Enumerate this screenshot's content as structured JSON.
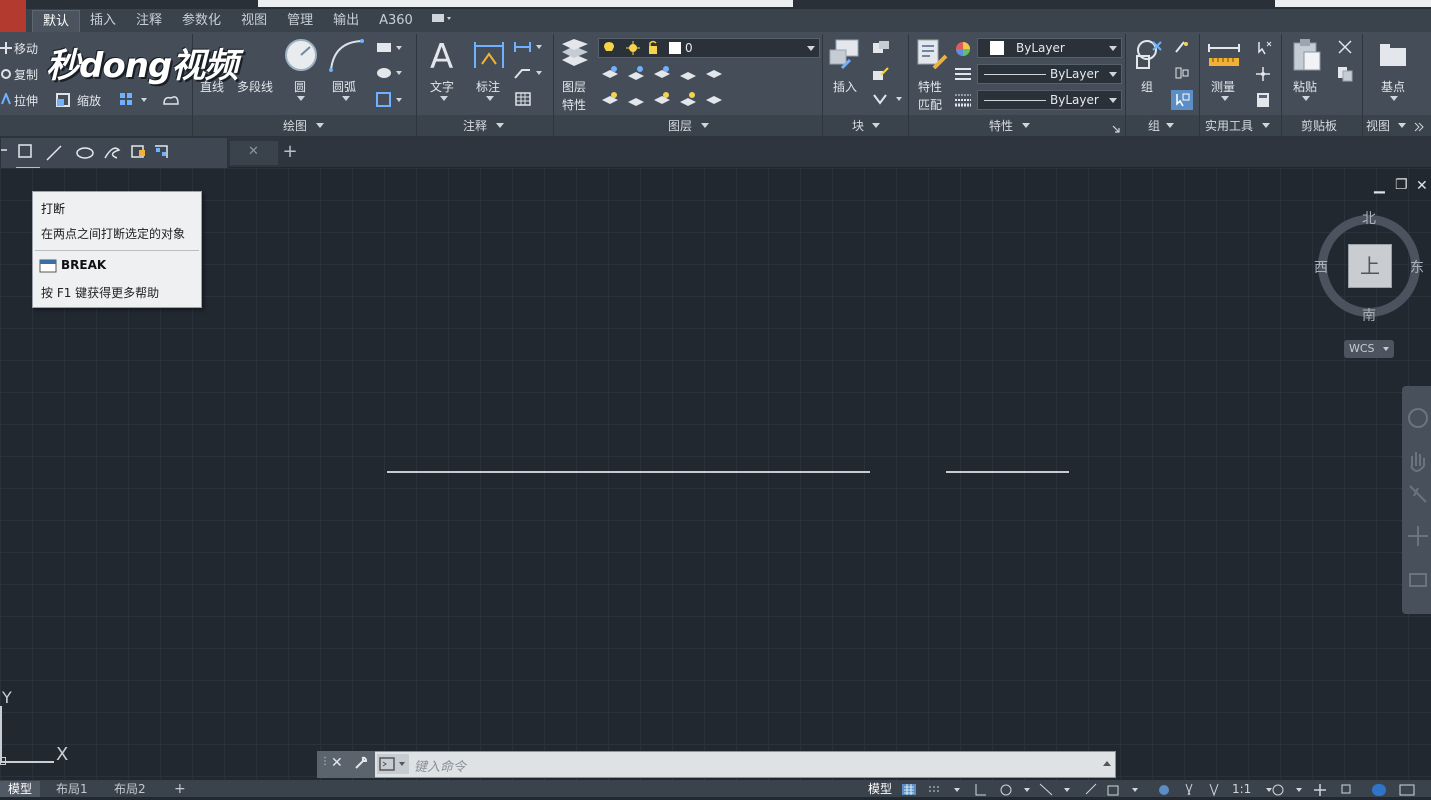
{
  "ribbon_tabs": [
    "默认",
    "插入",
    "注释",
    "参数化",
    "视图",
    "管理",
    "输出",
    "A360"
  ],
  "watermark": "秒dong视频",
  "modify": {
    "move": "移动",
    "copy": "复制",
    "stretch": "拉伸",
    "scale": "缩放"
  },
  "draw": {
    "line": "直线",
    "polyline": "多段线",
    "circle": "圆",
    "arc": "圆弧",
    "panel": "绘图"
  },
  "annotation": {
    "text": "文字",
    "dimension": "标注",
    "panel": "注释"
  },
  "layers": {
    "properties_line1": "图层",
    "properties_line2": "特性",
    "current_layer": "0",
    "panel": "图层"
  },
  "block": {
    "insert": "插入",
    "panel": "块"
  },
  "properties": {
    "match_line1": "特性",
    "match_line2": "匹配",
    "color": "ByLayer",
    "linetype": "ByLayer",
    "lineweight": "ByLayer",
    "panel": "特性"
  },
  "groups": {
    "group": "组",
    "panel": "组"
  },
  "utilities": {
    "measure": "测量",
    "panel": "实用工具"
  },
  "clipboard": {
    "paste": "粘贴",
    "panel": "剪贴板"
  },
  "view": {
    "base": "基点",
    "panel": "视图"
  },
  "tooltip": {
    "title": "打断",
    "description": "在两点之间打断选定的对象",
    "command": "BREAK",
    "help": "按 F1 键获得更多帮助"
  },
  "viewcube": {
    "north": "北",
    "south": "南",
    "east": "东",
    "west": "西",
    "face": "上",
    "wcs": "WCS"
  },
  "command_line": {
    "placeholder": "键入命令"
  },
  "layout_tabs": [
    "模型",
    "布局1",
    "布局2"
  ],
  "status": {
    "model": "模型",
    "scale": "1:1"
  },
  "ucs": {
    "x": "X",
    "y": "Y"
  },
  "colors": {
    "background": "#212830",
    "ribbon": "#444d58",
    "active_tab": "#4a535e",
    "tooltip": "#eef0f2"
  }
}
